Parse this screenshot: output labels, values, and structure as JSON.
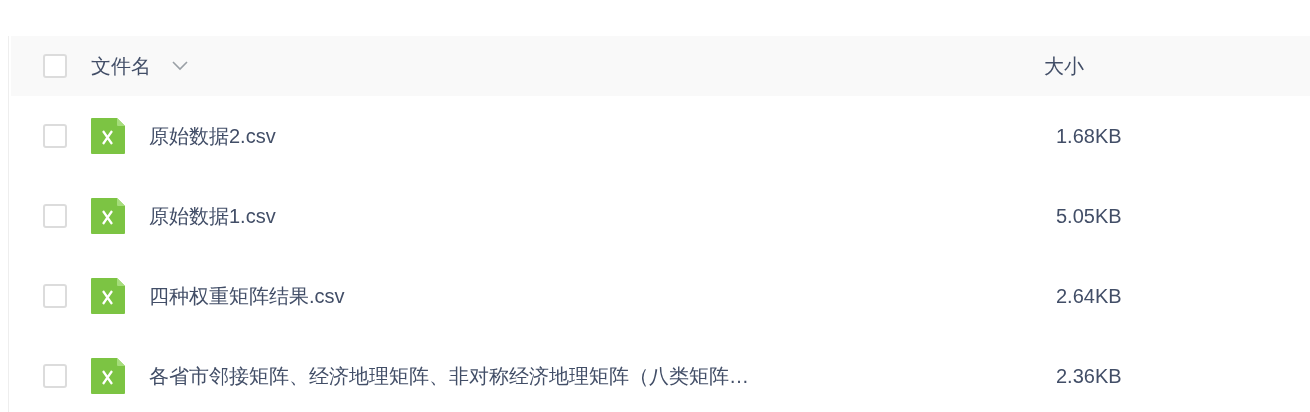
{
  "table": {
    "select_all": {
      "checked": false
    },
    "columns": [
      {
        "label": "文件名",
        "selected": false
      },
      {
        "label": "大小"
      }
    ],
    "rows": [
      {
        "name": "原始数据2.csv",
        "size": "1.68KB",
        "checked": false
      },
      {
        "name": "原始数据1.csv",
        "size": "5.05KB",
        "checked": false
      },
      {
        "name": "四种权重矩阵结果.csv",
        "size": "2.64KB",
        "checked": false
      },
      {
        "name": "各省市邻接矩阵、经济地理矩阵、非对称经济地理矩阵（八类矩阵…",
        "size": "2.36KB",
        "checked": false
      }
    ]
  }
}
